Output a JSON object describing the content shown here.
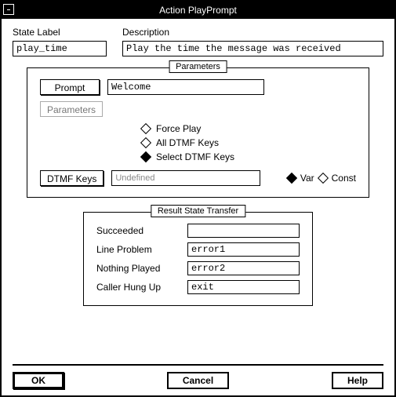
{
  "window": {
    "title": "Action PlayPrompt"
  },
  "top": {
    "state_label_caption": "State Label",
    "state_label_value": "play_time",
    "description_caption": "Description",
    "description_value": "Play the time the message was received"
  },
  "parameters": {
    "legend": "Parameters",
    "prompt_button": "Prompt",
    "prompt_value": "Welcome",
    "params_button": "Parameters",
    "force_play": "Force Play",
    "all_dtmf": "All DTMF Keys",
    "select_dtmf": "Select DTMF Keys",
    "dtmf_keys_button": "DTMF Keys",
    "dtmf_keys_value": "Undefined",
    "var_label": "Var",
    "const_label": "Const"
  },
  "result": {
    "legend": "Result State Transfer",
    "succeeded_label": "Succeeded",
    "succeeded_value": "",
    "line_problem_label": "Line Problem",
    "line_problem_value": "error1",
    "nothing_played_label": "Nothing Played",
    "nothing_played_value": "error2",
    "caller_hung_up_label": "Caller Hung Up",
    "caller_hung_up_value": "exit"
  },
  "buttons": {
    "ok": "OK",
    "cancel": "Cancel",
    "help": "Help"
  }
}
